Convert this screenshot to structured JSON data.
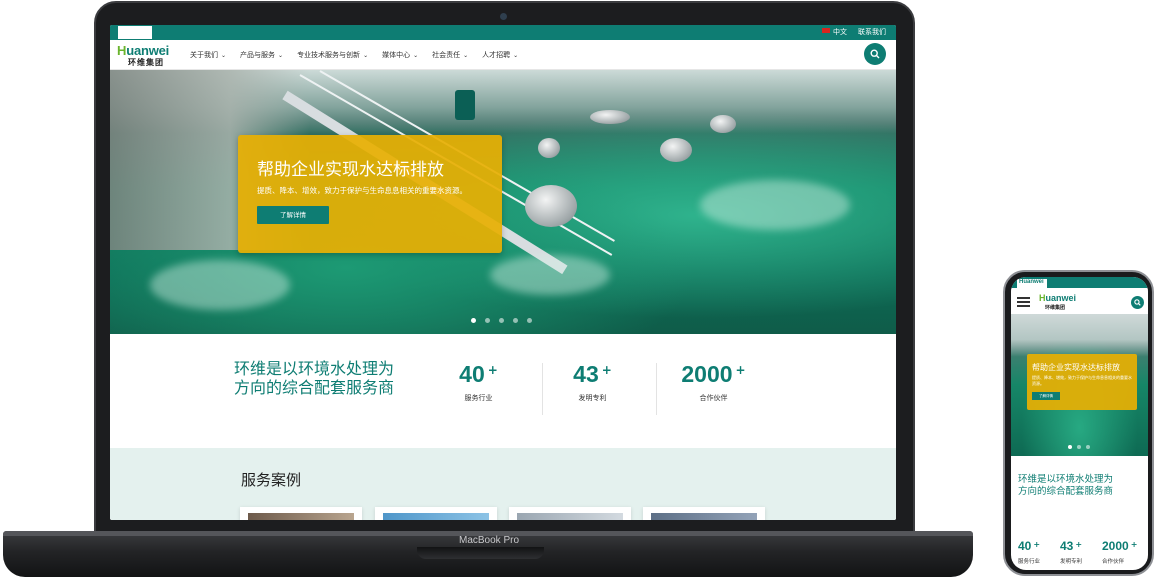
{
  "device": {
    "laptop_label": "MacBook Pro"
  },
  "topbar": {
    "language": "中文",
    "contact": "联系我们"
  },
  "brand": {
    "logo_first": "H",
    "logo_rest": "uanwei",
    "logo_small": "Huanwei",
    "name_cn": "环维集团"
  },
  "nav": {
    "items": [
      {
        "label": "关于我们"
      },
      {
        "label": "产品与服务"
      },
      {
        "label": "专业技术服务与创新"
      },
      {
        "label": "媒体中心"
      },
      {
        "label": "社会责任"
      },
      {
        "label": "人才招聘"
      }
    ]
  },
  "hero": {
    "title": "帮助企业实现水达标排放",
    "subtitle": "提质、降本、增效，致力于保护与生命息息相关的重要水资源。",
    "button": "了解详情",
    "slides_total": 5,
    "active_slide": 1
  },
  "stats": {
    "tagline": "环维是以环境水处理为方向的综合配套服务商",
    "items": [
      {
        "value": "40",
        "suffix": "+",
        "label": "服务行业"
      },
      {
        "value": "43",
        "suffix": "+",
        "label": "发明专利"
      },
      {
        "value": "2000",
        "suffix": "+",
        "label": "合作伙伴"
      }
    ]
  },
  "cases": {
    "title": "服务案例"
  },
  "colors": {
    "primary": "#0e7d73",
    "accent": "#e7af03",
    "logo_green": "#6ab42d",
    "section_bg": "#e4f1ee"
  },
  "icons": {
    "search": "search-icon",
    "menu": "menu-icon",
    "chevron": "chevron-down-icon",
    "flag": "flag-cn-icon"
  },
  "phone": {
    "hero_title": "帮助企业实现水达标排放",
    "hero_subtitle": "提质、降本、增效，致力于保护与生命息息相关的重要水资源。",
    "hero_button": "了解详情",
    "tagline": "环维是以环境水处理为方向的综合配套服务商",
    "stats": [
      {
        "value": "40",
        "suffix": "+",
        "label": "服务行业"
      },
      {
        "value": "43",
        "suffix": "+",
        "label": "发明专利"
      },
      {
        "value": "2000",
        "suffix": "+",
        "label": "合作伙伴"
      }
    ]
  }
}
